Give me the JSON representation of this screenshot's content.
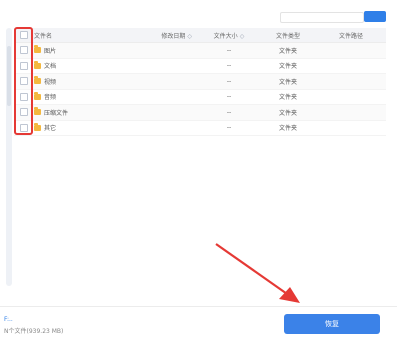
{
  "columns": {
    "name": "文件名",
    "date": "修改日期",
    "size": "文件大小",
    "type": "文件类型",
    "path": "文件路径",
    "sort_glyph": "◇"
  },
  "rows": [
    {
      "name": "图片",
      "size": "--",
      "type": "文件夹"
    },
    {
      "name": "文档",
      "size": "--",
      "type": "文件夹"
    },
    {
      "name": "视频",
      "size": "--",
      "type": "文件夹"
    },
    {
      "name": "音频",
      "size": "--",
      "type": "文件夹"
    },
    {
      "name": "压缩文件",
      "size": "--",
      "type": "文件夹"
    },
    {
      "name": "其它",
      "size": "--",
      "type": "文件夹"
    }
  ],
  "footer": {
    "link": "F:..",
    "count": "N个文件(939.23 MB)",
    "restore_label": "恢复"
  },
  "colors": {
    "accent": "#3b82e8",
    "annotation": "#e53935",
    "folder": "#f4b83f"
  }
}
